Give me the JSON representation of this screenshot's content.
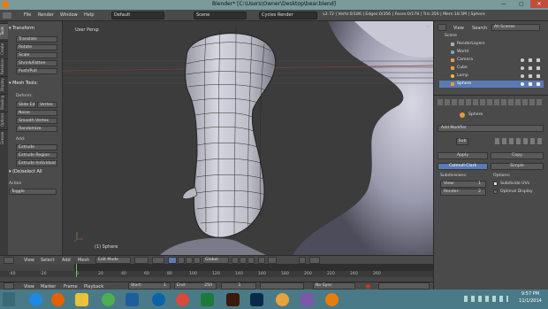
{
  "window": {
    "title": "Blender* [C:\\Users\\Owner\\Desktop\\bear.blend]",
    "minimize": "—",
    "maximize": "▢",
    "close": "✕"
  },
  "info_header": {
    "menus": [
      "File",
      "Render",
      "Window",
      "Help"
    ],
    "layout": "Default",
    "scene": "Scene",
    "engine": "Cycles Render",
    "stats": "v2.72 | Verts:0/186 | Edges:0/356 | Faces:0/178 | Tris:356 | Mem:18.5M | Sphere"
  },
  "tool_shelf": {
    "tabs": [
      "Tools",
      "Create",
      "Relations",
      "Display",
      "Shading",
      "Options",
      "Grease"
    ],
    "transform_panel": "Transform",
    "transform_buttons": [
      "Translate",
      "Rotate",
      "Scale",
      "Shrink/Fatten",
      "Push/Pull"
    ],
    "mesh_tools_panel": "Mesh Tools:",
    "deform_label": "Deform:",
    "deform_buttons": [
      "Slide Ed",
      "Vertex"
    ],
    "deform_more": [
      "Noise",
      "Smooth Vertex",
      "Randomize"
    ],
    "add_label": "Add:",
    "add_select": "Extrude",
    "add_buttons": [
      "Extrude Region",
      "Extrude Individual"
    ],
    "extrude_panel": "(De)select All",
    "action_label": "Action",
    "action_value": "Toggle"
  },
  "viewport": {
    "view_label": "User Persp",
    "object_label": "(1) Sphere"
  },
  "view3d_header": {
    "menus": [
      "View",
      "Select",
      "Add",
      "Mesh"
    ],
    "mode": "Edit Mode",
    "orientation": "Global"
  },
  "timeline": {
    "ticks": [
      "-40",
      "-20",
      "0",
      "20",
      "40",
      "60",
      "80",
      "100",
      "120",
      "140",
      "160",
      "180",
      "200",
      "220",
      "240",
      "260"
    ],
    "menus": [
      "View",
      "Marker",
      "Frame",
      "Playback"
    ],
    "start_label": "Start:",
    "start_value": "1",
    "end_label": "End:",
    "end_value": "250",
    "current_frame": "1",
    "sync": "No Sync"
  },
  "outliner": {
    "menus": [
      "View",
      "Search"
    ],
    "filter": "All Scenes",
    "items": [
      {
        "name": "Scene",
        "selected": false
      },
      {
        "name": "RenderLayers",
        "selected": false
      },
      {
        "name": "World",
        "selected": false
      },
      {
        "name": "Camera",
        "selected": false
      },
      {
        "name": "Cube",
        "selected": false
      },
      {
        "name": "Lamp",
        "selected": false
      },
      {
        "name": "Sphere",
        "selected": true
      }
    ]
  },
  "properties": {
    "object_name": "Sphere",
    "add_modifier": "Add Modifier",
    "modifier_name": "Sub",
    "apply": "Apply",
    "copy": "Copy",
    "catmull_clark": "Catmull-Clark",
    "simple": "Simple",
    "subdivisions_label": "Subdivisions:",
    "view_label": "View:",
    "view_value": "1",
    "render_label": "Render:",
    "render_value": "2",
    "options_label": "Options:",
    "subdivide_uvs": "Subdivide UVs",
    "optimal_display": "Optimal Display"
  },
  "taskbar": {
    "time": "9:57 PM",
    "date": "11/1/2014"
  },
  "colors": {
    "accent": "#5a7ab4",
    "titlebar": "#7a9a9c",
    "taskbar": "#4a7a88"
  }
}
